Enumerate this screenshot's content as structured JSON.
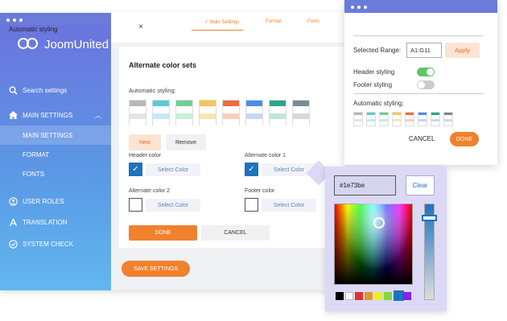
{
  "sidebar": {
    "logo_text": "JoomUnited",
    "search": "Search settings",
    "main_settings": "MAIN SETTINGS",
    "sub_items": [
      "MAIN SETTINGS",
      "FORMAT",
      "FONTS"
    ],
    "user_roles": "USER ROLES",
    "translation": "TRANSLATION",
    "system_check": "SYSTEM CHECK"
  },
  "tabs": [
    "✓ Main Settings",
    "Format",
    "Fonts"
  ],
  "card": {
    "title": "Alternate color sets",
    "auto_label": "Automatic styling:",
    "new_label": "New",
    "remove_label": "Remove",
    "header_color": "Header color",
    "alt_color_1": "Alternate color 1",
    "alt_color_2": "Alternate color 2",
    "footer_color": "Footer color",
    "select_color": "Select Color",
    "done": "DONE",
    "cancel": "CANCEL",
    "save": "SAVE SETTINGS"
  },
  "swatches": [
    [
      "#b8b8b8",
      "#fff",
      "#e4e4e4",
      "#fff"
    ],
    [
      "#5ec8d8",
      "#fff",
      "#c2ecf2",
      "#fff"
    ],
    [
      "#6fcf97",
      "#fff",
      "#c8efd8",
      "#fff"
    ],
    [
      "#f7c45a",
      "#fff",
      "#fbe4b3",
      "#fff"
    ],
    [
      "#ef6c3c",
      "#fff",
      "#f9cdbd",
      "#fff"
    ],
    [
      "#4a8df0",
      "#fff",
      "#c2d8fa",
      "#fff"
    ],
    [
      "#2aa58a",
      "#fff",
      "#bfe5dc",
      "#fff"
    ],
    [
      "#7a8a96",
      "#fff",
      "#d4dadf",
      "#fff"
    ]
  ],
  "popup": {
    "title": "Automatic styling",
    "range_label": "Selected Range:",
    "range_value": "A1:G11",
    "apply": "Apply",
    "header_styling": "Header styling",
    "footer_styling": "Footer styling",
    "auto_label": "Automatic styling:",
    "cancel": "CANCEL",
    "done": "DONE",
    "close": "×"
  },
  "picker": {
    "hex": "#1e73be",
    "clear": "Clear",
    "palette": [
      "#000000",
      "#ffffff",
      "#dd3333",
      "#dd9933",
      "#eeee22",
      "#81d742",
      "#1e73be",
      "#8224e3"
    ]
  },
  "colors": {
    "accent": "#f0812d",
    "brand": "#6b7bd9",
    "checkbox": "#1e73be"
  }
}
